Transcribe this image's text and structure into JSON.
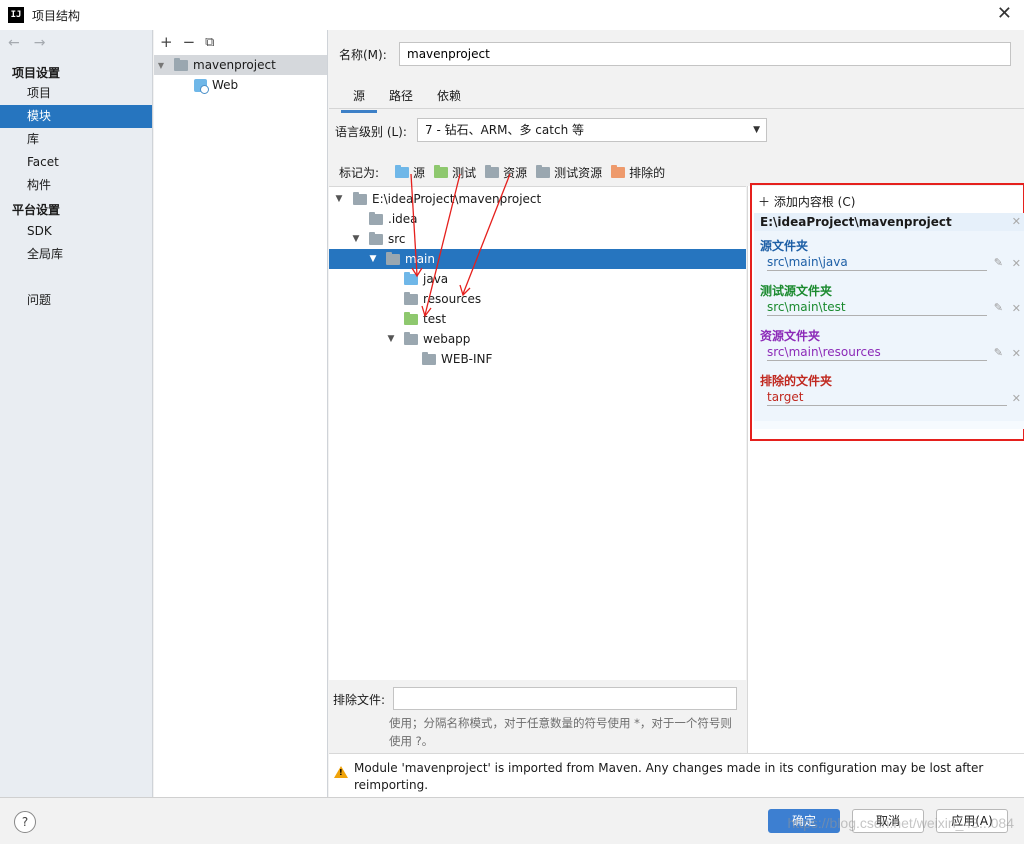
{
  "window": {
    "title": "项目结构",
    "app_icon_label": "IJ"
  },
  "leftnav": {
    "back_arrow": "←",
    "forward_arrow": "→",
    "project_settings_header": "项目设置",
    "project_items": [
      "项目",
      "模块",
      "库",
      "Facet",
      "构件"
    ],
    "platform_settings_header": "平台设置",
    "platform_items": [
      "SDK",
      "全局库"
    ],
    "problems": "问题",
    "selected": "模块"
  },
  "modules": {
    "toolbar": {
      "add": "+",
      "remove": "−",
      "copy": "⧉"
    },
    "items": [
      {
        "label": "mavenproject"
      },
      {
        "label": "Web"
      }
    ]
  },
  "main": {
    "name_label": "名称(M):",
    "name_value": "mavenproject",
    "tabs": [
      "源",
      "路径",
      "依赖"
    ],
    "active_tab": "源",
    "lang_label": "语言级别 (L):",
    "lang_value": "7 - 钻石、ARM、多 catch 等",
    "mark_as_label": "标记为:",
    "mark_as": [
      "源",
      "测试",
      "资源",
      "测试资源",
      "排除的"
    ],
    "tree": [
      {
        "label": "E:\\ideaProject\\mavenproject"
      },
      {
        "label": ".idea"
      },
      {
        "label": "src"
      },
      {
        "label": "main"
      },
      {
        "label": "java"
      },
      {
        "label": "resources"
      },
      {
        "label": "test"
      },
      {
        "label": "webapp"
      },
      {
        "label": "WEB-INF"
      }
    ],
    "exclude_label": "排除文件:",
    "exclude_value": "",
    "exclude_hint": "使用；分隔名称模式，对于任意数量的符号使用 *，对于一个符号则使用 ?。",
    "warning": "Module 'mavenproject' is imported from Maven. Any changes made in its configuration may be lost after reimporting."
  },
  "content_roots": {
    "add_label": "添加内容根 (C)",
    "root": "E:\\ideaProject\\mavenproject",
    "sections": [
      {
        "title": "源文件夹",
        "path": "src\\main\\java",
        "color": "#1d5fa6"
      },
      {
        "title": "测试源文件夹",
        "path": "src\\main\\test",
        "color": "#1a8a2e"
      },
      {
        "title": "资源文件夹",
        "path": "src\\main\\resources",
        "color": "#8c2ab8"
      },
      {
        "title": "排除的文件夹",
        "path": "target",
        "color": "#c0281f"
      }
    ],
    "highlight_color": "#e5201d"
  },
  "buttons": {
    "help": "?",
    "ok": "确定",
    "cancel": "取消",
    "apply": "应用(A)"
  },
  "watermark": "https://blog.csdn.net/weixin_43...084",
  "colors": {
    "selection": "#2675bf",
    "primary_button": "#3d7fd1",
    "annotation_arrow": "#e5201d"
  }
}
